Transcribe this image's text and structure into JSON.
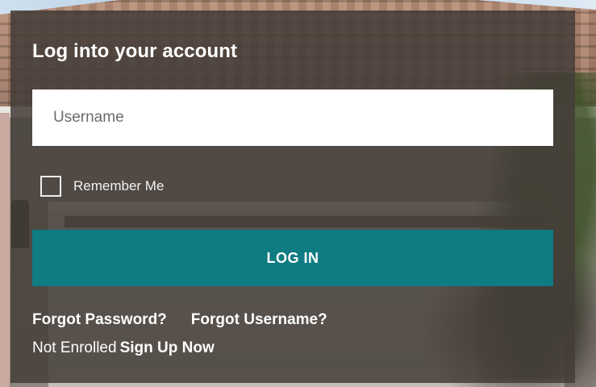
{
  "login": {
    "title": "Log into your account",
    "username_placeholder": "Username",
    "username_value": "",
    "remember_label": "Remember Me",
    "remember_checked": false,
    "login_button": "LOG IN",
    "forgot_password": "Forgot Password?",
    "forgot_username": "Forgot Username?",
    "not_enrolled_text": "Not Enrolled",
    "sign_up": "Sign Up Now"
  },
  "colors": {
    "panel_overlay": "#443c38",
    "button": "#0f7b82",
    "text": "#ffffff"
  }
}
